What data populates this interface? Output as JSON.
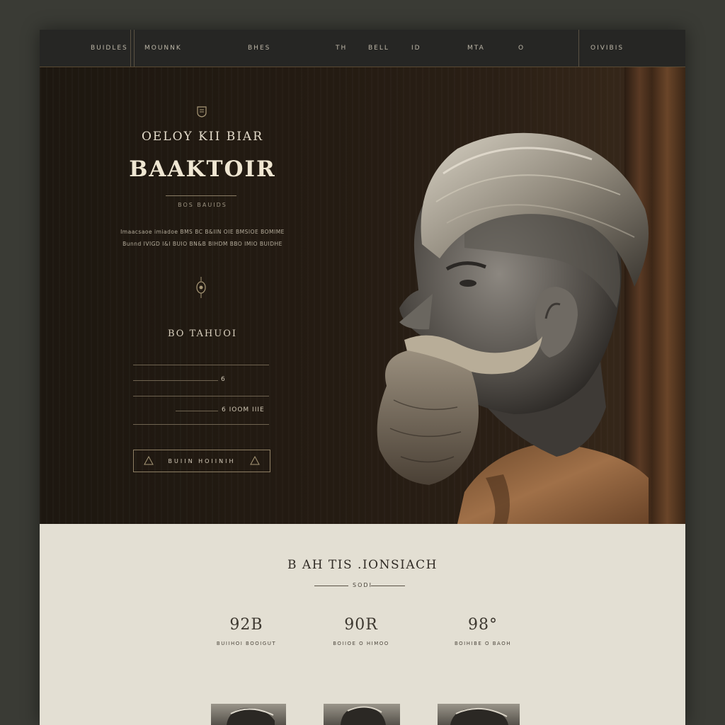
{
  "nav": {
    "left_label": "BUIDLES",
    "items": [
      "MOUNNK",
      "BHES",
      "TH",
      "BELL",
      "ID",
      "MTA",
      "O"
    ],
    "right_label": "OIVIBIS"
  },
  "hero": {
    "kicker": "OELOY KII BIAR",
    "title": "BAAKTOIR",
    "tagline": "BOS BAUIDS",
    "description_lines": [
      "Imaacsaoe imiadoe BMS BC B&IIN OIE BMSIOE BOMIME",
      "Bunnd IVIGD I&I BUIO BN&B BIHDM BBO IMIO BUIDHE"
    ],
    "section_title": "BO TAHUOI",
    "option_1": "6",
    "option_2": "6  IOOM IIIE",
    "button_label": "BUIIN HOIINIH"
  },
  "lower": {
    "title": "B AH TIS .IONSIACH",
    "subtitle": "SODI",
    "stats": [
      {
        "value": "92B",
        "label": "BUIIHOI BOOIGUT"
      },
      {
        "value": "90R",
        "label": "BOIIOE O HIMOO"
      },
      {
        "value": "98°",
        "label": "BOIHIBE O BAOH"
      }
    ]
  },
  "colors": {
    "hero_bg": "#241b12",
    "nav_bg": "#262624",
    "lower_bg": "#e3dfd3",
    "accent": "#8d7e63"
  }
}
